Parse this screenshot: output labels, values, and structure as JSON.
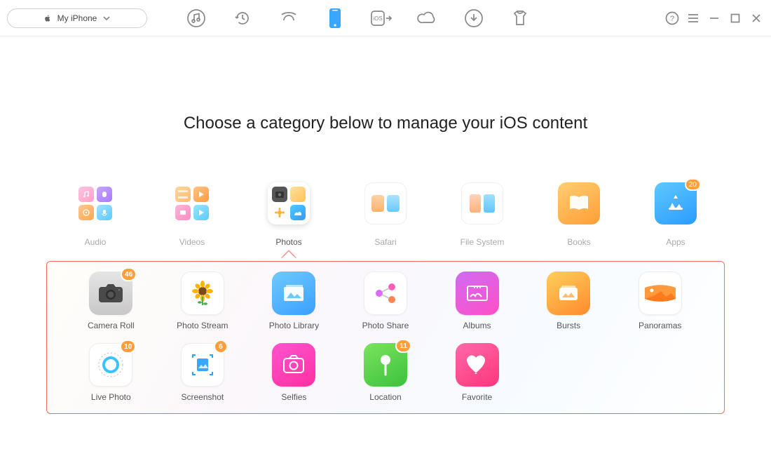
{
  "device_name": "My iPhone",
  "heading": "Choose a category below to manage your iOS content",
  "categories": [
    {
      "label": "Audio"
    },
    {
      "label": "Videos"
    },
    {
      "label": "Photos"
    },
    {
      "label": "Safari"
    },
    {
      "label": "File System"
    },
    {
      "label": "Books"
    },
    {
      "label": "Apps",
      "badge": 20
    }
  ],
  "active_category_index": 2,
  "photo_items": [
    {
      "label": "Camera Roll",
      "badge": 46,
      "color": "#cfcfcf"
    },
    {
      "label": "Photo Stream",
      "color": "#ffffff"
    },
    {
      "label": "Photo Library",
      "color": "#48b5ff"
    },
    {
      "label": "Photo Share",
      "color": "#ffffff"
    },
    {
      "label": "Albums",
      "color": "linear-gradient(160deg,#d06bf4,#ff4fc6)"
    },
    {
      "label": "Bursts",
      "color": "linear-gradient(160deg,#ffcf5b,#ff8a2c)"
    },
    {
      "label": "Panoramas",
      "color": "#ffffff"
    },
    {
      "label": "Live Photo",
      "badge": 10,
      "color": "#ffffff"
    },
    {
      "label": "Screenshot",
      "badge": 6,
      "color": "#ffffff"
    },
    {
      "label": "Selfies",
      "color": "linear-gradient(160deg,#ff55d0,#ff2fa0)"
    },
    {
      "label": "Location",
      "badge": 11,
      "color": "linear-gradient(160deg,#7ce35c,#3bc23e)"
    },
    {
      "label": "Favorite",
      "color": "linear-gradient(160deg,#ff6aa9,#ff357c)"
    }
  ]
}
